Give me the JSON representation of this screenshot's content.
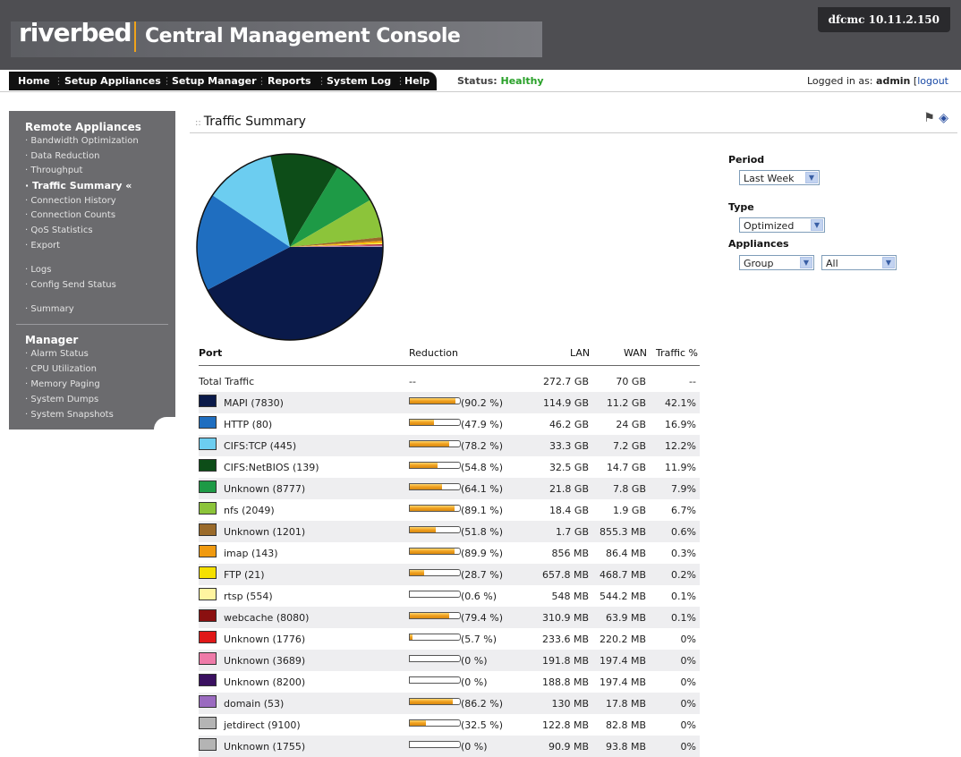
{
  "header": {
    "brand": "riverbed",
    "product": "Central Management Console",
    "host": "dfcmc 10.11.2.150"
  },
  "nav": {
    "items": [
      "Home",
      "Setup Appliances",
      "Setup Manager",
      "Reports",
      "System Log",
      "Help"
    ],
    "status_label": "Status:",
    "status_value": "Healthy",
    "login_prefix": "Logged in as:",
    "login_user": "admin",
    "login_bracket": "[",
    "logout": "logout"
  },
  "sidebar": {
    "section1": "Remote Appliances",
    "items1": [
      "Bandwidth Optimization",
      "Data Reduction",
      "Throughput",
      "Traffic Summary «",
      "Connection History",
      "Connection Counts",
      "QoS Statistics",
      "Export"
    ],
    "items2": [
      "Logs",
      "Config Send Status"
    ],
    "items3": [
      "Summary"
    ],
    "section2": "Manager",
    "items4": [
      "Alarm Status",
      "CPU Utilization",
      "Memory Paging",
      "System Dumps",
      "System Snapshots"
    ]
  },
  "page": {
    "title": "Traffic Summary",
    "title_marker": "::",
    "icons": [
      "print-icon",
      "help-book-icon"
    ]
  },
  "controls": {
    "period_label": "Period",
    "period_value": "Last Week",
    "type_label": "Type",
    "type_value": "Optimized",
    "appliances_label": "Appliances",
    "appliances_value": "Group",
    "appliances_group_value": "All"
  },
  "table": {
    "headers": {
      "port": "Port",
      "reduction": "Reduction",
      "lan": "LAN",
      "wan": "WAN",
      "traffic": "Traffic %"
    },
    "total": {
      "port": "Total Traffic",
      "reduction": "--",
      "lan": "272.7 GB",
      "wan": "70 GB",
      "traffic": "--"
    },
    "rows": [
      {
        "port": "MAPI (7830)",
        "color": "#0a1a4a",
        "reduction": 90.2,
        "reduction_label": "(90.2 %)",
        "lan": "114.9 GB",
        "wan": "11.2 GB",
        "traffic": "42.1%"
      },
      {
        "port": "HTTP (80)",
        "color": "#1f6ec0",
        "reduction": 47.9,
        "reduction_label": "(47.9 %)",
        "lan": "46.2 GB",
        "wan": "24 GB",
        "traffic": "16.9%"
      },
      {
        "port": "CIFS:TCP (445)",
        "color": "#6ccdf0",
        "reduction": 78.2,
        "reduction_label": "(78.2 %)",
        "lan": "33.3 GB",
        "wan": "7.2 GB",
        "traffic": "12.2%"
      },
      {
        "port": "CIFS:NetBIOS (139)",
        "color": "#0d4d18",
        "reduction": 54.8,
        "reduction_label": "(54.8 %)",
        "lan": "32.5 GB",
        "wan": "14.7 GB",
        "traffic": "11.9%"
      },
      {
        "port": "Unknown (8777)",
        "color": "#1e9a46",
        "reduction": 64.1,
        "reduction_label": "(64.1 %)",
        "lan": "21.8 GB",
        "wan": "7.8 GB",
        "traffic": "7.9%"
      },
      {
        "port": "nfs (2049)",
        "color": "#8cc43a",
        "reduction": 89.1,
        "reduction_label": "(89.1 %)",
        "lan": "18.4 GB",
        "wan": "1.9 GB",
        "traffic": "6.7%"
      },
      {
        "port": "Unknown (1201)",
        "color": "#9a6a2a",
        "reduction": 51.8,
        "reduction_label": "(51.8 %)",
        "lan": "1.7 GB",
        "wan": "855.3 MB",
        "traffic": "0.6%"
      },
      {
        "port": "imap (143)",
        "color": "#f09a10",
        "reduction": 89.9,
        "reduction_label": "(89.9 %)",
        "lan": "856 MB",
        "wan": "86.4 MB",
        "traffic": "0.3%"
      },
      {
        "port": "FTP (21)",
        "color": "#f5e000",
        "reduction": 28.7,
        "reduction_label": "(28.7 %)",
        "lan": "657.8 MB",
        "wan": "468.7 MB",
        "traffic": "0.2%"
      },
      {
        "port": "rtsp (554)",
        "color": "#fff4a0",
        "reduction": 0.6,
        "reduction_label": "(0.6 %)",
        "lan": "548 MB",
        "wan": "544.2 MB",
        "traffic": "0.1%"
      },
      {
        "port": "webcache (8080)",
        "color": "#8a1010",
        "reduction": 79.4,
        "reduction_label": "(79.4 %)",
        "lan": "310.9 MB",
        "wan": "63.9 MB",
        "traffic": "0.1%"
      },
      {
        "port": "Unknown (1776)",
        "color": "#e01818",
        "reduction": 5.7,
        "reduction_label": "(5.7 %)",
        "lan": "233.6 MB",
        "wan": "220.2 MB",
        "traffic": "0%"
      },
      {
        "port": "Unknown (3689)",
        "color": "#ee7aa8",
        "reduction": 0,
        "reduction_label": "(0 %)",
        "lan": "191.8 MB",
        "wan": "197.4 MB",
        "traffic": "0%"
      },
      {
        "port": "Unknown (8200)",
        "color": "#3a1060",
        "reduction": 0,
        "reduction_label": "(0 %)",
        "lan": "188.8 MB",
        "wan": "197.4 MB",
        "traffic": "0%"
      },
      {
        "port": "domain (53)",
        "color": "#9a6ac0",
        "reduction": 86.2,
        "reduction_label": "(86.2 %)",
        "lan": "130 MB",
        "wan": "17.8 MB",
        "traffic": "0%"
      },
      {
        "port": "jetdirect (9100)",
        "color": "#b4b4b4",
        "reduction": 32.5,
        "reduction_label": "(32.5 %)",
        "lan": "122.8 MB",
        "wan": "82.8 MB",
        "traffic": "0%"
      },
      {
        "port": "Unknown (1755)",
        "color": "#b4b4b4",
        "reduction": 0,
        "reduction_label": "(0 %)",
        "lan": "90.9 MB",
        "wan": "93.8 MB",
        "traffic": "0%"
      }
    ]
  },
  "chart_data": {
    "type": "pie",
    "labels": [
      "MAPI (7830)",
      "HTTP (80)",
      "CIFS:TCP (445)",
      "CIFS:NetBIOS (139)",
      "Unknown (8777)",
      "nfs (2049)",
      "Unknown (1201)",
      "imap (143)",
      "FTP (21)",
      "rtsp (554)",
      "webcache (8080)",
      "Unknown (1776)",
      "Unknown (3689)",
      "Unknown (8200)",
      "domain (53)",
      "jetdirect (9100)",
      "Unknown (1755)"
    ],
    "values": [
      42.1,
      16.9,
      12.2,
      11.9,
      7.9,
      6.7,
      0.6,
      0.3,
      0.2,
      0.1,
      0.1,
      0.1,
      0.07,
      0.07,
      0.05,
      0.05,
      0.03
    ],
    "colors": [
      "#0a1a4a",
      "#1f6ec0",
      "#6ccdf0",
      "#0d4d18",
      "#1e9a46",
      "#8cc43a",
      "#9a6a2a",
      "#f09a10",
      "#f5e000",
      "#fff4a0",
      "#8a1010",
      "#e01818",
      "#ee7aa8",
      "#3a1060",
      "#9a6ac0",
      "#b4b4b4",
      "#b4b4b4"
    ]
  }
}
